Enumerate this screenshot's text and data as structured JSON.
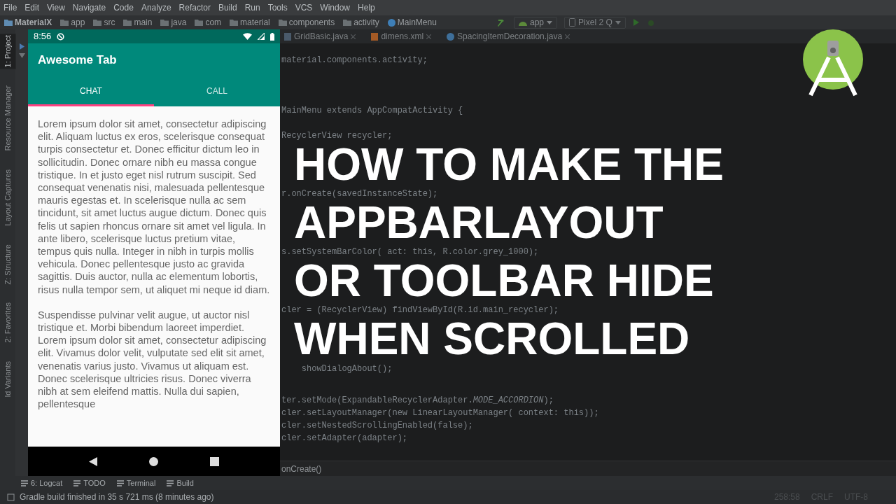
{
  "menu_bar": [
    "File",
    "Edit",
    "View",
    "Navigate",
    "Code",
    "Analyze",
    "Refactor",
    "Build",
    "Run",
    "Tools",
    "VCS",
    "Window",
    "Help"
  ],
  "breadcrumbs": [
    "MaterialX",
    "app",
    "src",
    "main",
    "java",
    "com",
    "material",
    "components",
    "activity",
    "MainMenu"
  ],
  "run_config": {
    "module": "app",
    "device": "Pixel 2 Q"
  },
  "editor_tabs": [
    {
      "label": "GridBasic.java",
      "selected": false
    },
    {
      "label": "dimens.xml",
      "selected": false
    },
    {
      "label": "SpacingItemDecoration.java",
      "selected": false
    }
  ],
  "left_tool_strip": [
    {
      "label": "1: Project",
      "selected": true
    },
    {
      "label": "Resource Manager",
      "selected": false
    },
    {
      "label": "Layout Captures",
      "selected": false
    },
    {
      "label": "Z: Structure",
      "selected": false
    },
    {
      "label": "2: Favorites",
      "selected": false
    },
    {
      "label": "ld Variants",
      "selected": false
    }
  ],
  "code_lines": [
    "material.components.activity;",
    "MainMenu extends AppCompatActivity {",
    "RecyclerView recycler;",
    "r.onCreate(savedInstanceState);",
    "s.setSystemBarColor( act: this, R.color.grey_1000);",
    "cler = (RecyclerView) findViewById(R.id.main_recycler);",
    "    showDialogAbout();",
    "ter.setMode(ExpandableRecyclerAdapter.*MODE_ACCORDION*);",
    "cler.setLayoutManager(new LinearLayoutManager( context: this));",
    "cler.setNestedScrollingEnabled(false);",
    "cler.setAdapter(adapter);"
  ],
  "editor_breadcrumb": "onCreate()",
  "tool_windows": [
    "6: Logcat",
    "TODO",
    "Terminal",
    "Build"
  ],
  "status_bar": {
    "message": "Gradle build finished in 35 s 721 ms (8 minutes ago)",
    "position": "258:58",
    "line_separator": "CRLF",
    "encoding": "UTF-8"
  },
  "phone": {
    "time": "8:56",
    "app_title": "Awesome Tab",
    "tabs": [
      {
        "label": "CHAT",
        "selected": true
      },
      {
        "label": "CALL",
        "selected": false
      }
    ],
    "paragraphs": [
      "Lorem ipsum dolor sit amet, consectetur adipiscing elit. Aliquam luctus ex eros, scelerisque consequat turpis consectetur et. Donec efficitur dictum leo in sollicitudin. Donec ornare nibh eu massa congue tristique. In et justo eget nisl rutrum suscipit. Sed consequat venenatis nisi, malesuada pellentesque mauris egestas et. In scelerisque nulla ac sem tincidunt, sit amet luctus augue dictum. Donec quis felis ut sapien rhoncus ornare sit amet vel ligula. In ante libero, scelerisque luctus pretium vitae, tempus quis nulla. Integer in nibh in turpis mollis vehicula. Donec pellentesque justo ac gravida sagittis. Duis auctor, nulla ac elementum lobortis, risus nulla tempor sem, ut aliquet mi neque id diam.",
      "Suspendisse pulvinar velit augue, ut auctor nisl tristique et. Morbi bibendum laoreet imperdiet. Lorem ipsum dolor sit amet, consectetur adipiscing elit. Vivamus dolor velit, vulputate sed elit sit amet, venenatis varius justo. Vivamus ut aliquam est. Donec scelerisque ultricies risus. Donec viverra nibh at sem eleifend mattis. Nulla dui sapien, pellentesque"
    ]
  },
  "title_lines": [
    "HOW TO MAKE THE",
    "APPBARLAYOUT",
    "OR TOOLBAR HIDE",
    "WHEN SCROLLED"
  ]
}
